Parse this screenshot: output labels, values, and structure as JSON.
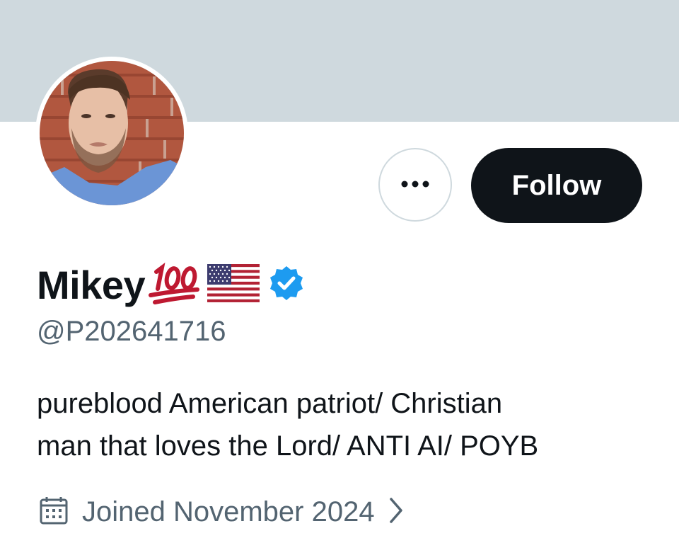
{
  "profile": {
    "display_name": "Mikey",
    "name_emoji": "hundred-points-icon",
    "name_flag": "us-flag-icon",
    "verified_badge": "verified-badge-icon",
    "handle": "@P202641716",
    "bio_lines": [
      "pureblood American patriot/ Christian",
      "man that loves the Lord/ ANTI AI/ POYB"
    ],
    "joined": "Joined November 2024",
    "joined_icon": "calendar-icon"
  },
  "actions": {
    "more_icon": "more-options-icon",
    "follow_label": "Follow"
  },
  "colors": {
    "banner": "#cfd9de",
    "primary_text": "#0f1419",
    "secondary_text": "#536471",
    "verified_blue": "#1d9bf0",
    "follow_bg": "#0f1419",
    "emoji_red": "#be1931"
  }
}
